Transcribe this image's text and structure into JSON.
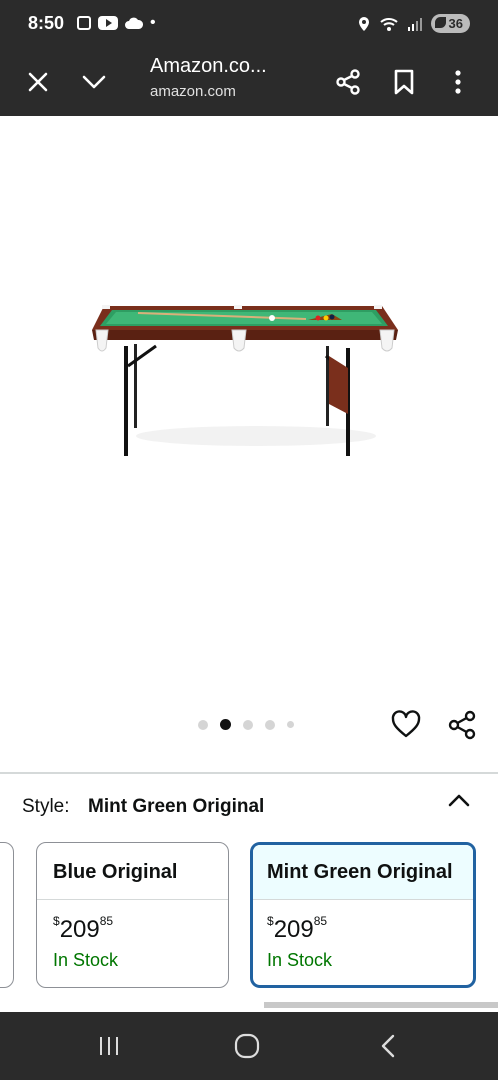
{
  "status": {
    "time": "8:50",
    "dot": "•",
    "battery": "36"
  },
  "toolbar": {
    "title": "Amazon.co...",
    "url": "amazon.com"
  },
  "gallery": {
    "dot_count": 5,
    "active_index": 1
  },
  "style": {
    "label": "Style:",
    "value": "Mint Green Original"
  },
  "options": [
    {
      "name": "Blue Original",
      "price_symbol": "$",
      "price_whole": "209",
      "price_fraction": "85",
      "stock": "In Stock"
    },
    {
      "name": "Mint Green Original",
      "price_symbol": "$",
      "price_whole": "209",
      "price_fraction": "85",
      "stock": "In Stock",
      "selected": true
    }
  ],
  "colors": {
    "chrome": "#2b2b2b",
    "in_stock": "#007600",
    "selected_border": "#2162a1",
    "selected_header": "#edfdff"
  },
  "icons": {
    "toolbar": [
      "close-icon",
      "chevron-down-icon",
      "share-icon",
      "bookmark-icon",
      "more-vertical-icon"
    ],
    "product": [
      "heart-icon",
      "share-icon"
    ],
    "nav": [
      "recents-icon",
      "home-icon",
      "back-icon"
    ]
  }
}
